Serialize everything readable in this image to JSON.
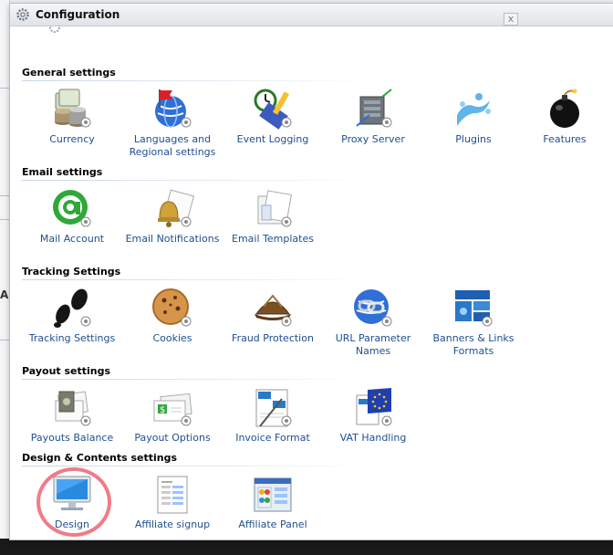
{
  "dialog": {
    "title": "Configuration",
    "close_label": "x"
  },
  "sections": [
    {
      "title": "General settings",
      "items": [
        {
          "label": "Currency",
          "icon": "coins-icon"
        },
        {
          "label": "Languages and Regional settings",
          "icon": "globe-flag-icon"
        },
        {
          "label": "Event Logging",
          "icon": "clock-pencil-icon"
        },
        {
          "label": "Proxy Server",
          "icon": "server-icon"
        },
        {
          "label": "Plugins",
          "icon": "puzzle-splash-icon"
        },
        {
          "label": "Features",
          "icon": "bomb-icon"
        }
      ]
    },
    {
      "title": "Email settings",
      "items": [
        {
          "label": "Mail Account",
          "icon": "at-sign-icon"
        },
        {
          "label": "Email Notifications",
          "icon": "bell-envelope-icon"
        },
        {
          "label": "Email Templates",
          "icon": "envelope-template-icon"
        }
      ]
    },
    {
      "title": "Tracking Settings",
      "items": [
        {
          "label": "Tracking Settings",
          "icon": "footprints-icon"
        },
        {
          "label": "Cookies",
          "icon": "cookie-icon"
        },
        {
          "label": "Fraud Protection",
          "icon": "detective-hat-icon"
        },
        {
          "label": "URL Parameter Names",
          "icon": "link-globe-icon"
        },
        {
          "label": "Banners & Links Formats",
          "icon": "banners-icon"
        }
      ]
    },
    {
      "title": "Payout settings",
      "items": [
        {
          "label": "Payouts Balance",
          "icon": "money-card-icon"
        },
        {
          "label": "Payout Options",
          "icon": "dollar-card-icon"
        },
        {
          "label": "Invoice Format",
          "icon": "invoice-pen-icon"
        },
        {
          "label": "VAT Handling",
          "icon": "eu-flag-icon"
        }
      ]
    },
    {
      "title": "Design & Contents settings",
      "items": [
        {
          "label": "Design",
          "icon": "monitor-icon"
        },
        {
          "label": "Affiliate signup",
          "icon": "signup-form-icon"
        },
        {
          "label": "Affiliate Panel",
          "icon": "panel-window-icon"
        }
      ]
    }
  ],
  "colors": {
    "label_link": "#1f4f8f",
    "highlight": "#f07c86"
  }
}
